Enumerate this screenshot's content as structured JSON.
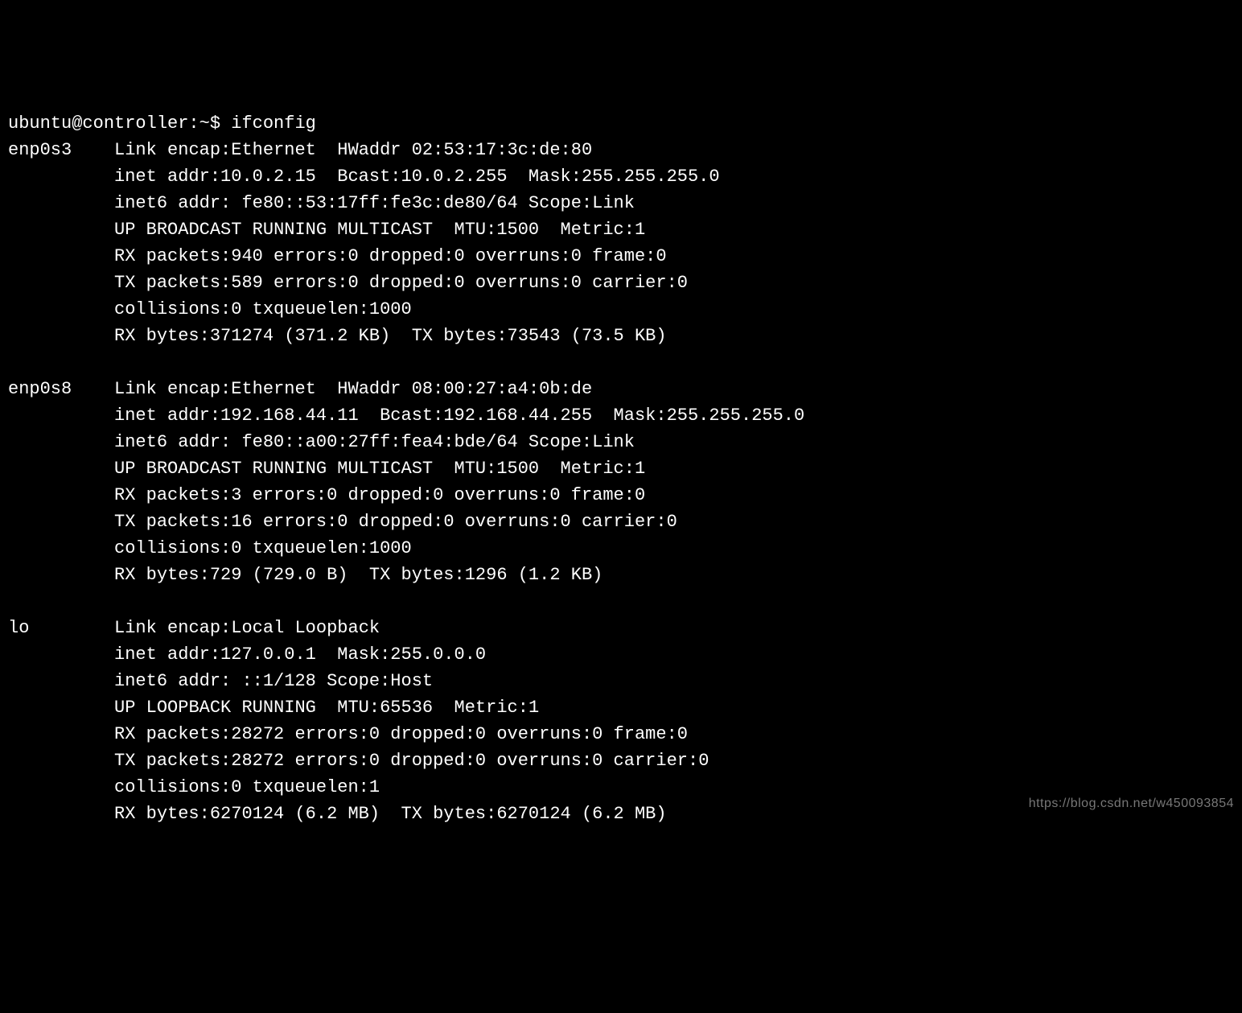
{
  "prompt": "ubuntu@controller:~$ ",
  "command": "ifconfig",
  "interfaces": [
    {
      "name": "enp0s3",
      "pad": "   ",
      "link_encap": "Ethernet",
      "hwaddr": "02:53:17:3c:de:80",
      "inet_addr": "10.0.2.15",
      "bcast": "10.0.2.255",
      "mask": "255.255.255.0",
      "inet6_addr": "fe80::53:17ff:fe3c:de80/64",
      "scope": "Link",
      "flags": "UP BROADCAST RUNNING MULTICAST",
      "mtu": "1500",
      "metric": "1",
      "rx_packets": "940",
      "rx_errors": "0",
      "rx_dropped": "0",
      "rx_overruns": "0",
      "rx_frame": "0",
      "tx_packets": "589",
      "tx_errors": "0",
      "tx_dropped": "0",
      "tx_overruns": "0",
      "tx_carrier": "0",
      "collisions": "0",
      "txqueuelen": "1000",
      "rx_bytes": "371274",
      "rx_bytes_h": "(371.2 KB)",
      "tx_bytes": "73543",
      "tx_bytes_h": "(73.5 KB)"
    },
    {
      "name": "enp0s8",
      "pad": "   ",
      "link_encap": "Ethernet",
      "hwaddr": "08:00:27:a4:0b:de",
      "inet_addr": "192.168.44.11",
      "bcast": "192.168.44.255",
      "mask": "255.255.255.0",
      "inet6_addr": "fe80::a00:27ff:fea4:bde/64",
      "scope": "Link",
      "flags": "UP BROADCAST RUNNING MULTICAST",
      "mtu": "1500",
      "metric": "1",
      "rx_packets": "3",
      "rx_errors": "0",
      "rx_dropped": "0",
      "rx_overruns": "0",
      "rx_frame": "0",
      "tx_packets": "16",
      "tx_errors": "0",
      "tx_dropped": "0",
      "tx_overruns": "0",
      "tx_carrier": "0",
      "collisions": "0",
      "txqueuelen": "1000",
      "rx_bytes": "729",
      "rx_bytes_h": "(729.0 B)",
      "tx_bytes": "1296",
      "tx_bytes_h": "(1.2 KB)"
    },
    {
      "name": "lo",
      "pad": "       ",
      "link_encap": "Local Loopback",
      "hwaddr": "",
      "inet_addr": "127.0.0.1",
      "bcast": "",
      "mask": "255.0.0.0",
      "inet6_addr": "::1/128",
      "scope": "Host",
      "flags": "UP LOOPBACK RUNNING",
      "mtu": "65536",
      "metric": "1",
      "rx_packets": "28272",
      "rx_errors": "0",
      "rx_dropped": "0",
      "rx_overruns": "0",
      "rx_frame": "0",
      "tx_packets": "28272",
      "tx_errors": "0",
      "tx_dropped": "0",
      "tx_overruns": "0",
      "tx_carrier": "0",
      "collisions": "0",
      "txqueuelen": "1",
      "rx_bytes": "6270124",
      "rx_bytes_h": "(6.2 MB)",
      "tx_bytes": "6270124",
      "tx_bytes_h": "(6.2 MB)"
    }
  ],
  "watermark": "https://blog.csdn.net/w450093854"
}
